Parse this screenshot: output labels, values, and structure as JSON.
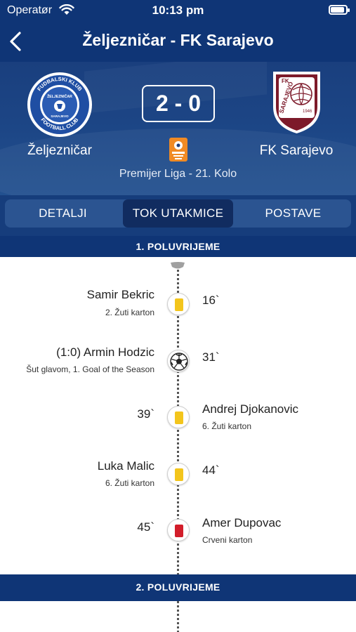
{
  "status_bar": {
    "carrier": "Operatør",
    "time": "10:13 pm"
  },
  "nav": {
    "title": "Željezničar - FK Sarajevo"
  },
  "match": {
    "home_team": "Željezničar",
    "away_team": "FK Sarajevo",
    "score": "2 - 0",
    "league": "Premijer Liga - 21. Kolo",
    "home_crest": {
      "top_text": "FUDBALSKI KLUB",
      "middle_text": "ŽELJEZNIČAR",
      "bottom_text": "FOOTBALL CLUB",
      "city": "SARAJEVO"
    },
    "away_crest": {
      "text": "SARAJEVO",
      "letters": "FK",
      "year": "1946"
    }
  },
  "tabs": [
    {
      "label": "DETALJI",
      "active": false
    },
    {
      "label": "TOK UTAKMICE",
      "active": true
    },
    {
      "label": "POSTAVE",
      "active": false
    }
  ],
  "sections": {
    "first_half": "1. POLUVRIJEME",
    "second_half": "2. POLUVRIJEME"
  },
  "events": [
    {
      "side": "home",
      "type": "yellow-card",
      "player": "Samir Bekric",
      "detail": "2. Žuti karton",
      "minute": "16`"
    },
    {
      "side": "home",
      "type": "goal",
      "player": "(1:0)  Armin Hodzic",
      "detail": "Šut glavom, 1. Goal of the Season",
      "minute": "31`"
    },
    {
      "side": "away",
      "type": "yellow-card",
      "player": "Andrej Djokanovic",
      "detail": "6. Žuti karton",
      "minute": "39`"
    },
    {
      "side": "home",
      "type": "yellow-card",
      "player": "Luka Malic",
      "detail": "6. Žuti karton",
      "minute": "44`"
    },
    {
      "side": "away",
      "type": "red-card",
      "player": "Amer Dupovac",
      "detail": "Crveni karton",
      "minute": "45`"
    }
  ],
  "colors": {
    "primary": "#0f3576",
    "tab_track": "#2b5491",
    "tab_active": "#112c60",
    "yellow_card": "#f3c51c",
    "red_card": "#d21d2a"
  }
}
